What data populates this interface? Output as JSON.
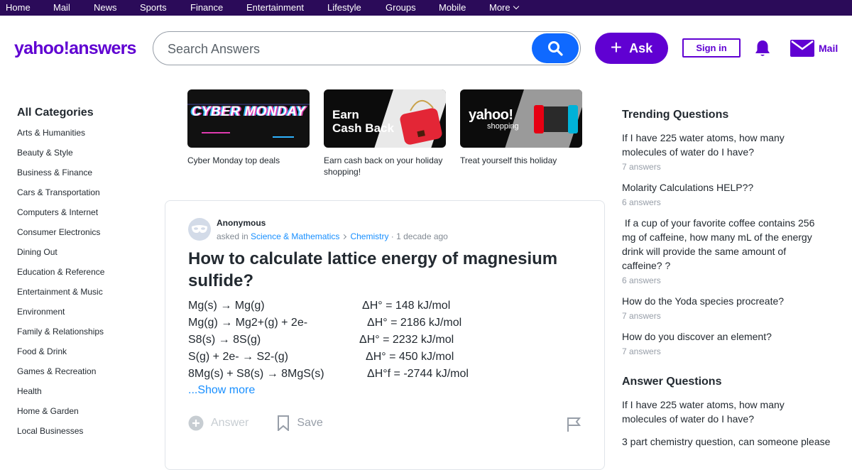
{
  "topnav": {
    "items": [
      "Home",
      "Mail",
      "News",
      "Sports",
      "Finance",
      "Entertainment",
      "Lifestyle",
      "Groups",
      "Mobile",
      "More"
    ]
  },
  "header": {
    "logo": "yahoo!answers",
    "search_placeholder": "Search Answers",
    "ask_label": "Ask",
    "signin_label": "Sign in",
    "mail_label": "Mail"
  },
  "sidebar": {
    "title": "All Categories",
    "items": [
      "Arts & Humanities",
      "Beauty & Style",
      "Business & Finance",
      "Cars & Transportation",
      "Computers & Internet",
      "Consumer Electronics",
      "Dining Out",
      "Education & Reference",
      "Entertainment & Music",
      "Environment",
      "Family & Relationships",
      "Food & Drink",
      "Games & Recreation",
      "Health",
      "Home & Garden",
      "Local Businesses"
    ]
  },
  "promos": [
    {
      "art": "CYBER MONDAY",
      "caption": "Cyber Monday top deals"
    },
    {
      "art_line1": "Earn",
      "art_line2": "Cash Back",
      "caption": "Earn cash back on your holiday shopping!"
    },
    {
      "art_line1": "yahoo!",
      "art_line2": "shopping",
      "caption": "Treat yourself this holiday"
    }
  ],
  "question": {
    "author": "Anonymous",
    "asked_in": "asked in",
    "category": "Science & Mathematics",
    "subcategory": "Chemistry",
    "time": "· 1 decade ago",
    "title": "How to calculate lattice energy of magnesium sulfide?",
    "rows": [
      {
        "reaction": "Mg(s) → Mg(g)",
        "enthalpy": "ΔH° = 148 kJ/mol"
      },
      {
        "reaction": "Mg(g) → Mg2+(g) + 2e-",
        "enthalpy": "ΔH° = 2186 kJ/mol"
      },
      {
        "reaction": "S8(s) → 8S(g)",
        "enthalpy": "ΔH° = 2232 kJ/mol"
      },
      {
        "reaction": "S(g) + 2e- → S2-(g)",
        "enthalpy": "ΔH° = 450 kJ/mol"
      },
      {
        "reaction": "8Mg(s) + S8(s) → 8MgS(s)",
        "enthalpy": "ΔH°f = -2744 kJ/mol"
      }
    ],
    "show_more": "...Show more",
    "answer_label": "Answer",
    "save_label": "Save"
  },
  "trending": {
    "title": "Trending Questions",
    "items": [
      {
        "q": "If I have 225 water atoms, how many molecules of water do I have?",
        "count": "7 answers"
      },
      {
        "q": "Molarity Calculations HELP??",
        "count": "6 answers"
      },
      {
        "q": " If a cup of your favorite coffee contains 256 mg of caffeine, how many mL of the energy drink will provide the same amount of caffeine? ?",
        "count": "6 answers"
      },
      {
        "q": "How do the Yoda species procreate?",
        "count": "7 answers"
      },
      {
        "q": "How do you discover an element?",
        "count": "7 answers"
      }
    ]
  },
  "answer_questions": {
    "title": "Answer Questions",
    "items": [
      {
        "q": "If I have 225 water atoms, how many molecules of water do I have?"
      },
      {
        "q": "3 part chemistry question, can someone please"
      }
    ]
  },
  "colors": {
    "brand": "#6001d2",
    "topnav_bg": "#2b0b59",
    "search_button": "#0f69ff",
    "link": "#188fff"
  }
}
